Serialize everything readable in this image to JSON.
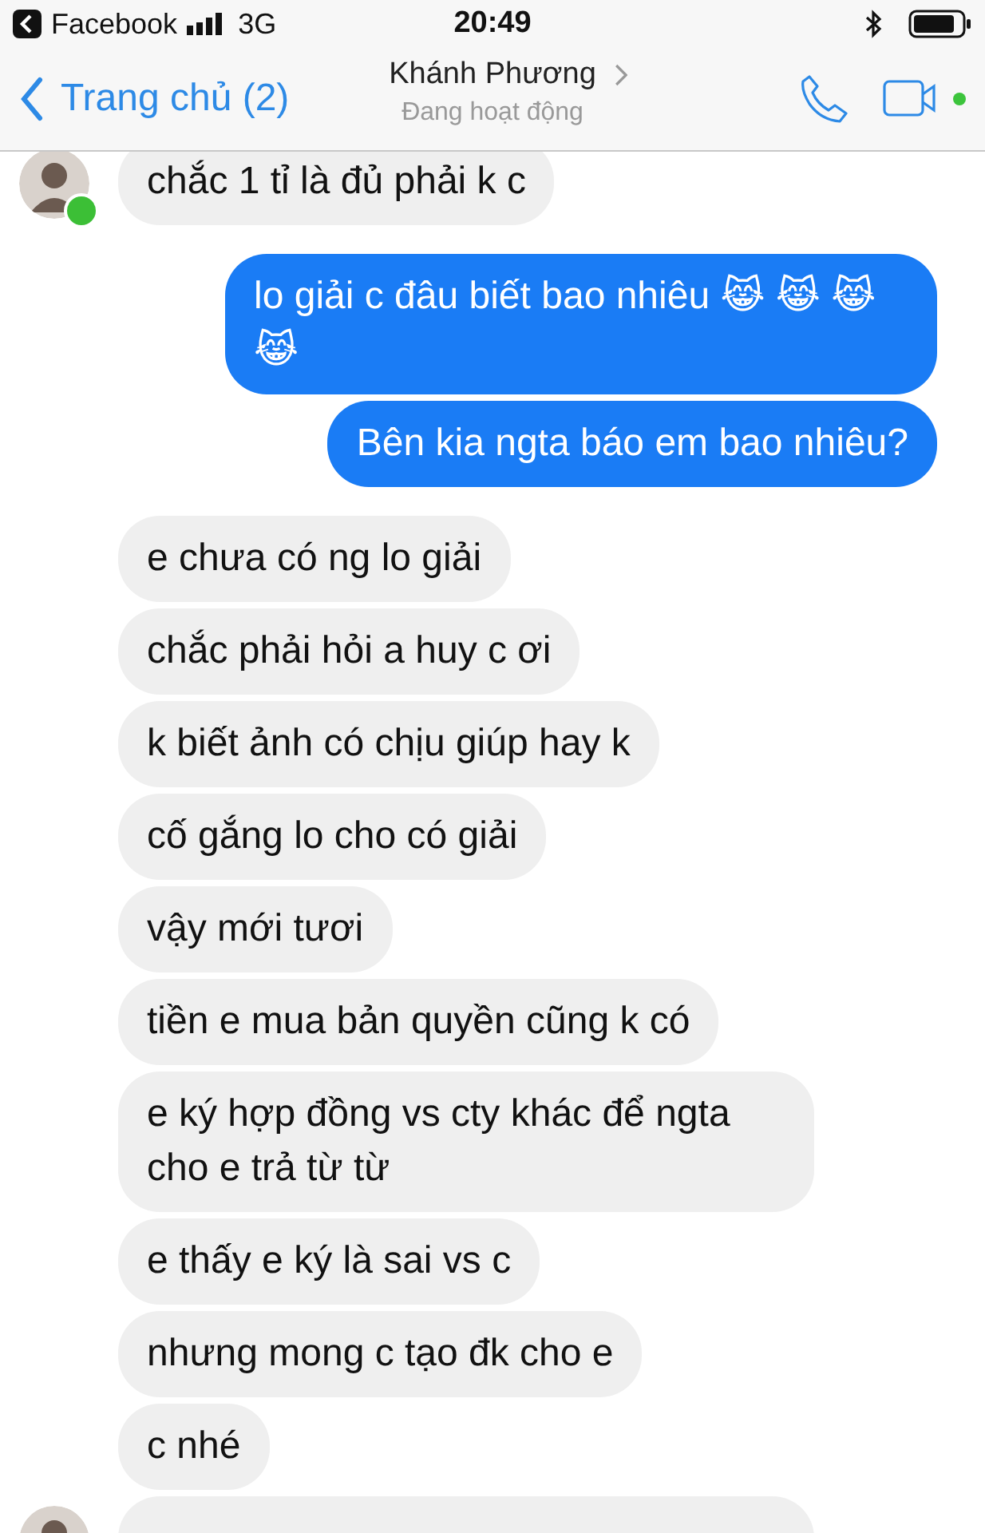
{
  "status_bar": {
    "back_app": "Facebook",
    "network": "3G",
    "time": "20:49"
  },
  "header": {
    "back_label": "Trang chủ (2)",
    "contact_name": "Khánh Phương",
    "contact_status": "Đang hoạt động",
    "online": true
  },
  "messages": [
    {
      "kind": "received",
      "text": "chắc 1 tỉ là đủ phải k c",
      "avatar": true,
      "online": true
    },
    {
      "kind": "sent",
      "text": "lo giải c đâu biết bao nhiêu 😹 😹 😹 😹"
    },
    {
      "kind": "sent",
      "text": "Bên kia ngta báo em bao nhiêu?"
    },
    {
      "kind": "received",
      "text": "e chưa có ng lo giải"
    },
    {
      "kind": "received",
      "text": "chắc phải hỏi a huy c ơi"
    },
    {
      "kind": "received",
      "text": "k biết ảnh có chịu giúp hay k"
    },
    {
      "kind": "received",
      "text": "cố gắng lo cho có giải"
    },
    {
      "kind": "received",
      "text": "vậy mới tươi"
    },
    {
      "kind": "received",
      "text": "tiền e mua bản quyền cũng k có"
    },
    {
      "kind": "received",
      "text": "e ký hợp đồng vs cty khác để ngta cho e trả từ từ"
    },
    {
      "kind": "received",
      "text": "e thấy e ký là sai vs c"
    },
    {
      "kind": "received",
      "text": "nhưng mong c tạo đk cho e"
    },
    {
      "kind": "received",
      "text": "c nhé"
    },
    {
      "kind": "received",
      "avatar": true
    }
  ]
}
